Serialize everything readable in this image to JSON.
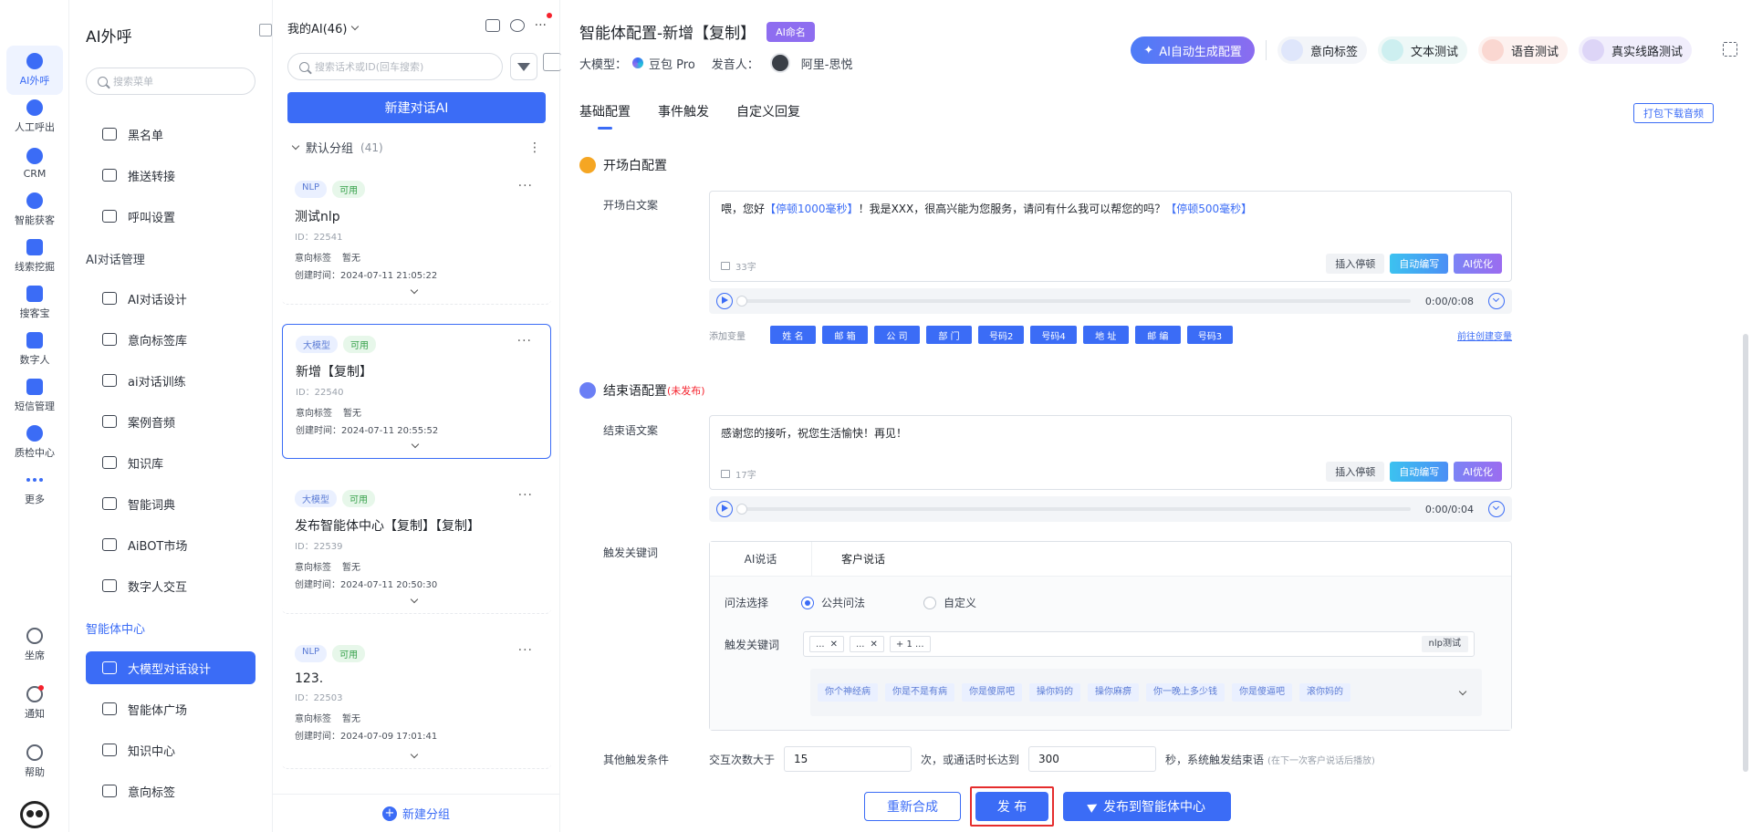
{
  "rail": {
    "items": [
      {
        "label": "AI外呼"
      },
      {
        "label": "人工呼出"
      },
      {
        "label": "CRM"
      },
      {
        "label": "智能获客"
      },
      {
        "label": "线索挖掘"
      },
      {
        "label": "搜客宝"
      },
      {
        "label": "数字人"
      },
      {
        "label": "短信管理"
      },
      {
        "label": "质检中心"
      },
      {
        "label": "更多"
      },
      {
        "label": "坐席"
      },
      {
        "label": "通知"
      },
      {
        "label": "帮助"
      }
    ],
    "accent": "#3b6cf6"
  },
  "menu": {
    "title": "AI外呼",
    "search_placeholder": "搜索菜单",
    "items_top": [
      {
        "label": "黑名单"
      },
      {
        "label": "推送转接"
      },
      {
        "label": "呼叫设置"
      }
    ],
    "section_dialog": "AI对话管理",
    "items_dialog": [
      {
        "label": "AI对话设计"
      },
      {
        "label": "意向标签库"
      },
      {
        "label": "ai对话训练"
      },
      {
        "label": "案例音频"
      },
      {
        "label": "知识库"
      },
      {
        "label": "智能词典"
      },
      {
        "label": "AiBOT市场"
      },
      {
        "label": "数字人交互"
      }
    ],
    "section_agent": "智能体中心",
    "items_agent": [
      {
        "label": "大模型对话设计"
      },
      {
        "label": "智能体广场"
      },
      {
        "label": "知识中心"
      },
      {
        "label": "意向标签"
      }
    ]
  },
  "list": {
    "header": "我的AI(46)",
    "search_placeholder": "搜索话术或ID(回车搜索)",
    "new_button": "新建对话AI",
    "group_name": "默认分组",
    "group_count": "(41)",
    "new_group": "新建分组",
    "cards": [
      {
        "type": "NLP",
        "status": "可用",
        "name": "测试nlp",
        "id": "ID：22541",
        "intent_label": "意向标签",
        "intent_value": "暂无",
        "created": "创建时间：2024-07-11 21:05:22"
      },
      {
        "type": "大模型",
        "status": "可用",
        "name": "新增【复制】",
        "id": "ID：22540",
        "intent_label": "意向标签",
        "intent_value": "暂无",
        "created": "创建时间：2024-07-11 20:55:52"
      },
      {
        "type": "大模型",
        "status": "可用",
        "name": "发布智能体中心【复制】【复制】",
        "id": "ID：22539",
        "intent_label": "意向标签",
        "intent_value": "暂无",
        "created": "创建时间：2024-07-11 20:50:30"
      },
      {
        "type": "NLP",
        "status": "可用",
        "name": "123.",
        "id": "ID：22503",
        "intent_label": "意向标签",
        "intent_value": "暂无",
        "created": "创建时间：2024-07-09 17:01:41"
      }
    ]
  },
  "main": {
    "title": "智能体配置-新增【复制】",
    "badge": "AI命名",
    "model_label": "大模型：",
    "model_value": "豆包 Pro",
    "speaker_label": "发音人：",
    "speaker_value": "阿里-思悦",
    "gen_button": "AI自动生成配置",
    "pills": [
      {
        "label": "意向标签"
      },
      {
        "label": "文本测试"
      },
      {
        "label": "语音测试"
      },
      {
        "label": "真实线路测试"
      }
    ],
    "tabs": [
      {
        "label": "基础配置"
      },
      {
        "label": "事件触发"
      },
      {
        "label": "自定义回复"
      }
    ],
    "download_button": "打包下载音频",
    "opening": {
      "section_title": "开场白配置",
      "field_label": "开场白文案",
      "text_1": "喂，您好",
      "pause_1": "【停顿1000毫秒】",
      "text_2": "！我是XXX，很高兴能为您服务，请问有什么我可以帮您的吗？",
      "pause_2": "【停顿500毫秒】",
      "char_count": "33字",
      "btn_insert": "插入停顿",
      "btn_auto": "自动编写",
      "btn_ai": "AI优化",
      "time": "0:00/0:08",
      "vars_label": "添加变量",
      "vars": [
        "姓 名",
        "邮 箱",
        "公 司",
        "部 门",
        "号码2",
        "号码4",
        "地 址",
        "邮 编",
        "号码3"
      ],
      "vars_link": "前往创建变量"
    },
    "closing": {
      "section_title": "结束语配置",
      "warn": "(未发布)",
      "field_label": "结束语文案",
      "text": "感谢您的接听，祝您生活愉快！再见！",
      "char_count": "17字",
      "btn_insert": "插入停顿",
      "btn_auto": "自动编写",
      "btn_ai": "AI优化",
      "time": "0:00/0:04"
    },
    "trigger": {
      "label": "触发关键词",
      "tabs": [
        {
          "label": "AI说话"
        },
        {
          "label": "客户说话"
        }
      ],
      "method_label": "问法选择",
      "opt_public": "公共问法",
      "opt_custom": "自定义",
      "keyword_label": "触发关键词",
      "chips": [
        "...",
        "..."
      ],
      "more_chip": "+ 1 ...",
      "nlp_chip": "nlp测试",
      "keywords": [
        "你个神经病",
        "你是不是有病",
        "你是傻屌吧",
        "操你妈的",
        "操你麻痹",
        "你一晚上多少钱",
        "你是傻逼吧",
        "滚你妈的"
      ]
    },
    "other": {
      "label": "其他触发条件",
      "prefix": "交互次数大于",
      "count_value": "15",
      "mid": "次，或通话时长达到",
      "seconds_value": "300",
      "suffix": "秒，系统触发结束语",
      "note": "(在下一次客户说话后播放)"
    },
    "buttons": {
      "resynth": "重新合成",
      "publish": "发 布",
      "publish_center": "发布到智能体中心"
    }
  }
}
